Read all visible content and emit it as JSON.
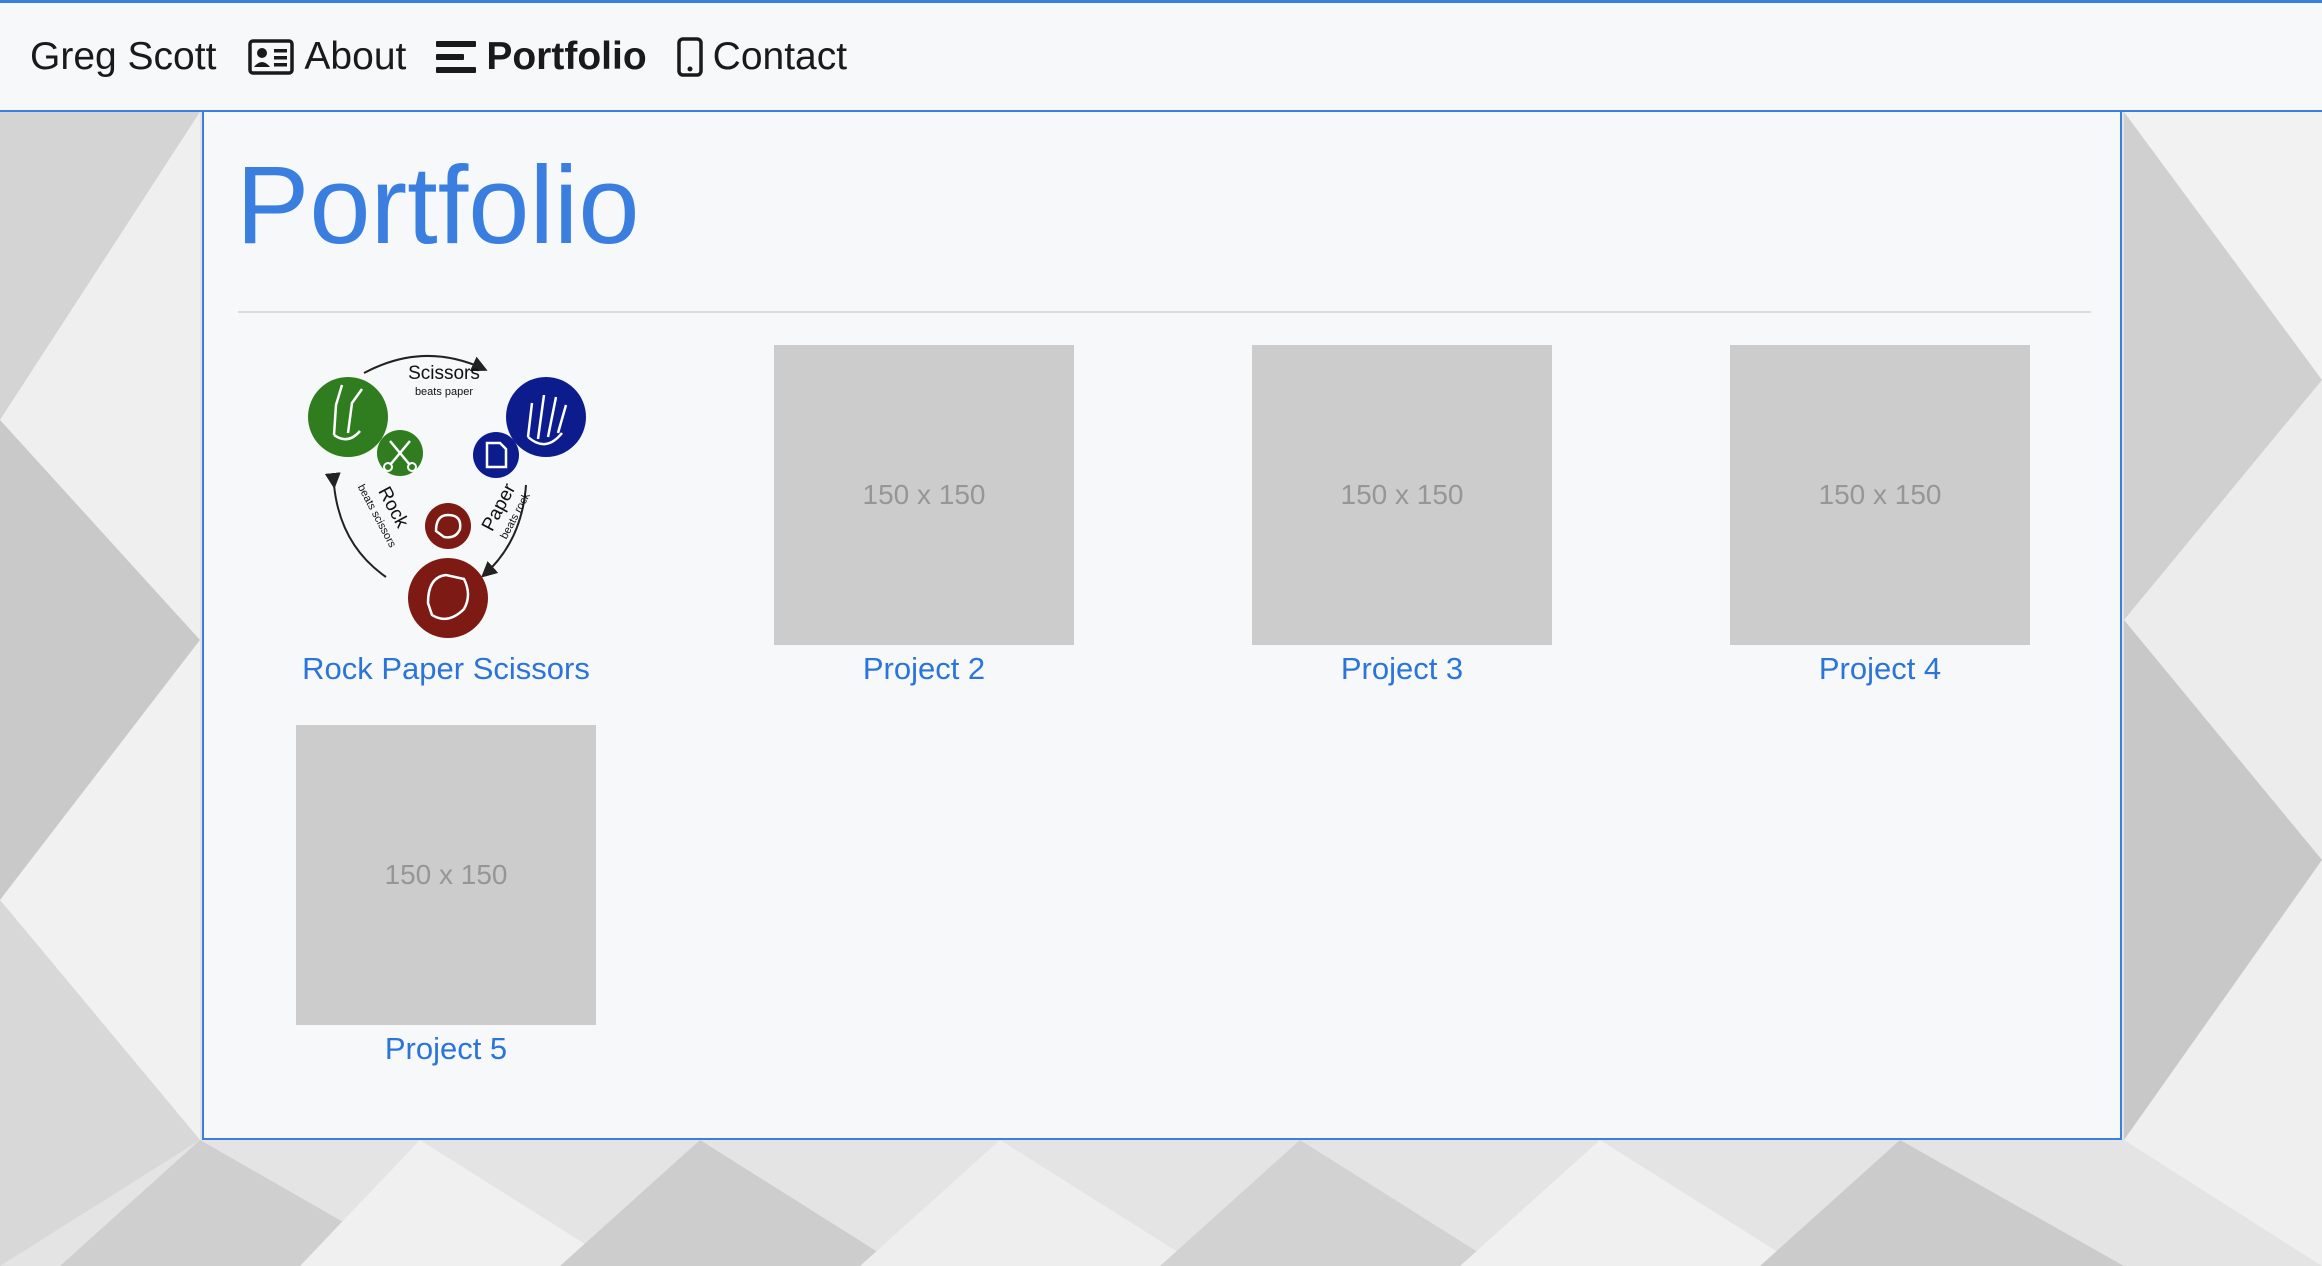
{
  "navbar": {
    "brand": "Greg Scott",
    "links": [
      {
        "label": "About",
        "icon": "id-card-icon"
      },
      {
        "label": "Portfolio",
        "icon": "bars-icon",
        "active": true
      },
      {
        "label": "Contact",
        "icon": "mobile-phone-icon"
      }
    ]
  },
  "main": {
    "title": "Portfolio",
    "projects": [
      {
        "name": "Rock Paper Scissors",
        "image": "rock-paper-scissors-logo"
      },
      {
        "name": "Project 2",
        "placeholder": "150 x 150"
      },
      {
        "name": "Project 3",
        "placeholder": "150 x 150"
      },
      {
        "name": "Project 4",
        "placeholder": "150 x 150"
      },
      {
        "name": "Project 5",
        "placeholder": "150 x 150"
      }
    ],
    "rps_logo": {
      "scissors_label": "Scissors",
      "scissors_sub": "beats paper",
      "rock_label": "Rock",
      "rock_sub": "beats scissors",
      "paper_label": "Paper",
      "paper_sub": "beats rock"
    }
  },
  "colors": {
    "accent": "#3a7fe0",
    "link": "#2b74d9",
    "rock": "#7d1a13",
    "paper": "#0c1c8c",
    "scissors": "#2f7d1e"
  }
}
